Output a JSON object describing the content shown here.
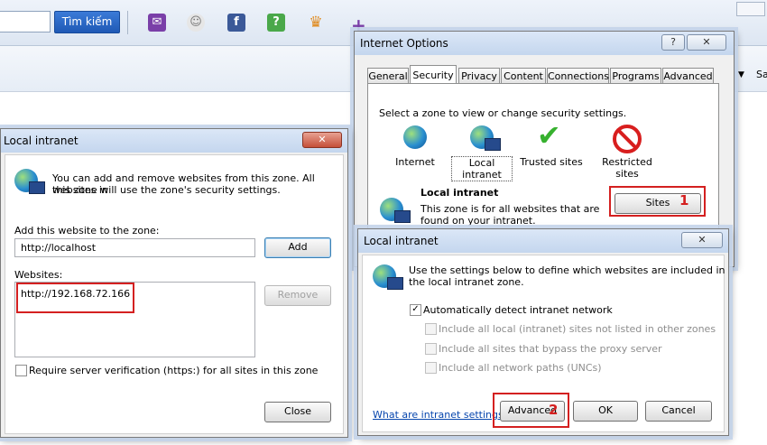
{
  "browser": {
    "search_button": "Tìm kiếm",
    "menu_partial": "Sa",
    "colors": {
      "accent": "#1f59b5",
      "mail": "#7a3fa8",
      "facebook": "#3b5998",
      "green": "#4aa84a",
      "trophy": "#e08a1e"
    }
  },
  "internet_options": {
    "title": "Internet Options",
    "help_btn": "?",
    "tabs": [
      "General",
      "Security",
      "Privacy",
      "Content",
      "Connections",
      "Programs",
      "Advanced"
    ],
    "prompt": "Select a zone to view or change security settings.",
    "zones": [
      "Internet",
      "Local intranet",
      "Trusted sites",
      "Restricted sites"
    ],
    "zone_title": "Local intranet",
    "zone_desc_line1": "This zone is for all websites that are",
    "zone_desc_line2": "found on your intranet.",
    "sites_button": "Sites",
    "annotation": "1"
  },
  "local_intranet_left": {
    "title": "Local intranet",
    "info_line1": "You can add and remove websites from this zone. All websites in",
    "info_line2": "this zone will use the zone's security settings.",
    "add_label": "Add this website to the zone:",
    "add_value": "http://localhost",
    "add_button": "Add",
    "websites_label": "Websites:",
    "websites": [
      "http://192.168.72.166"
    ],
    "remove_button": "Remove",
    "require_https_label": "Require server verification (https:) for all sites in this zone",
    "close_button": "Close"
  },
  "local_intranet_right": {
    "title": "Local intranet",
    "info_line1": "Use the settings below to define which websites are included in",
    "info_line2": "the local intranet zone.",
    "auto_detect": "Automatically detect intranet network",
    "option1": "Include all local (intranet) sites not listed in other zones",
    "option2": "Include all sites that bypass the proxy server",
    "option3": "Include all network paths (UNCs)",
    "link": "What are intranet settings?",
    "advanced_button": "Advanced",
    "ok_button": "OK",
    "cancel_button": "Cancel",
    "annotation": "2"
  }
}
